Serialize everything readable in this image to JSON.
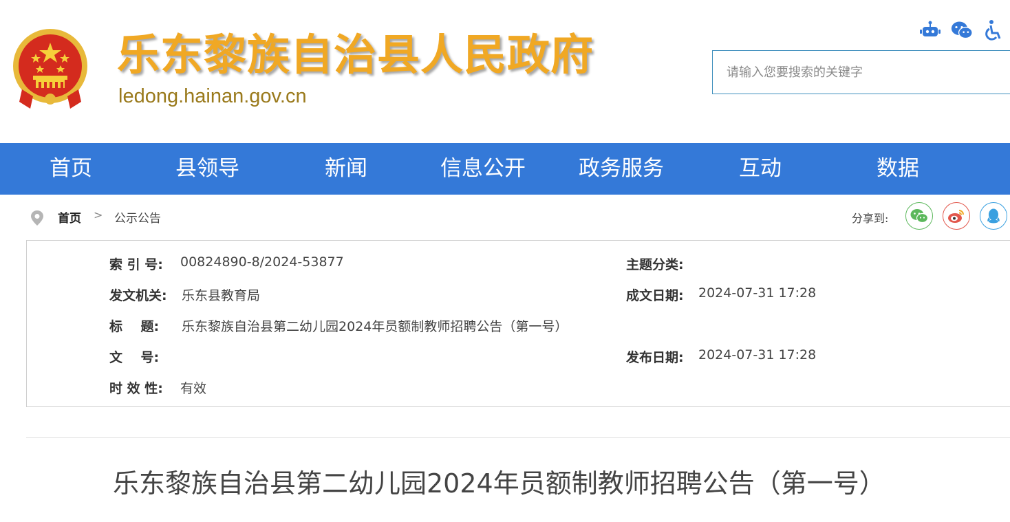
{
  "header": {
    "site_title": "乐东黎族自治县人民政府",
    "site_domain": "ledong.hainan.gov.cn",
    "search_placeholder": "请输入您要搜索的关键字",
    "top_icons": [
      "robot-icon",
      "wechat-icon",
      "accessibility-icon"
    ]
  },
  "nav": {
    "items": [
      {
        "label": "首页"
      },
      {
        "label": "县领导"
      },
      {
        "label": "新闻"
      },
      {
        "label": "信息公开"
      },
      {
        "label": "政务服务"
      },
      {
        "label": "互动"
      },
      {
        "label": "数据"
      }
    ]
  },
  "breadcrumb": {
    "home": "首页",
    "separator": ">",
    "current": "公示公告"
  },
  "share": {
    "label": "分享到:",
    "buttons": [
      {
        "icon": "wechat-icon",
        "color": "#5cb85c"
      },
      {
        "icon": "weibo-icon",
        "color": "#e2574c"
      },
      {
        "icon": "qq-icon",
        "color": "#39a0e0"
      }
    ]
  },
  "info": {
    "index_label": "索 引 号:",
    "index_value": "00824890-8/2024-53877",
    "subject_label": "主题分类:",
    "subject_value": "",
    "issuer_label": "发文机关:",
    "issuer_value": "乐东县教育局",
    "created_label": "成文日期:",
    "created_value": "2024-07-31 17:28",
    "title_label": "标    题:",
    "title_value": "乐东黎族自治县第二幼儿园2024年员额制教师招聘公告（第一号）",
    "docno_label": "文    号:",
    "docno_value": "",
    "published_label": "发布日期:",
    "published_value": "2024-07-31 17:28",
    "validity_label": "时 效 性:",
    "validity_value": "有效"
  },
  "article": {
    "title": "乐东黎族自治县第二幼儿园2024年员额制教师招聘公告（第一号）"
  },
  "colors": {
    "nav_bg": "#3479d8",
    "title_gold": "#f0a824",
    "domain_gold": "#9a7a1c"
  }
}
